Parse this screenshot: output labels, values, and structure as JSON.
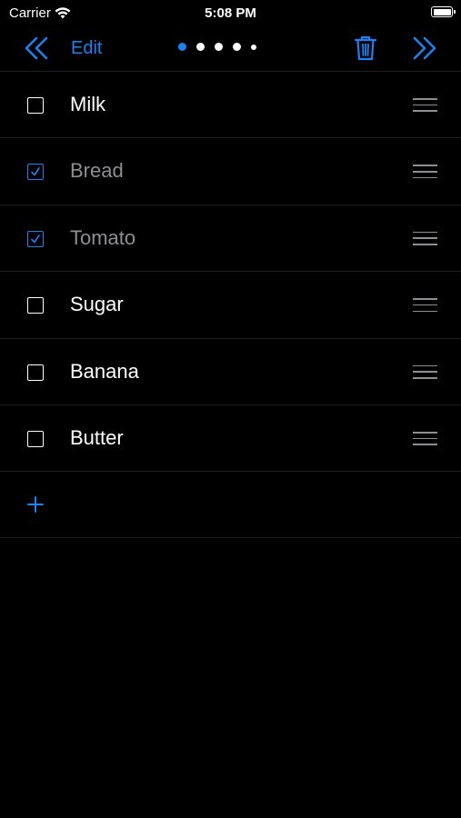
{
  "status_bar": {
    "carrier": "Carrier",
    "time": "5:08 PM"
  },
  "nav": {
    "back_icon": "double-chevron-left-icon",
    "edit_label": "Edit",
    "page_indicator": {
      "count": 5,
      "active_index": 0
    },
    "delete_icon": "trash-icon",
    "forward_icon": "double-chevron-right-icon"
  },
  "list": {
    "items": [
      {
        "label": "Milk",
        "checked": false
      },
      {
        "label": "Bread",
        "checked": true
      },
      {
        "label": "Tomato",
        "checked": true
      },
      {
        "label": "Sugar",
        "checked": false
      },
      {
        "label": "Banana",
        "checked": false
      },
      {
        "label": "Butter",
        "checked": false
      }
    ],
    "add_icon": "plus-icon"
  },
  "colors": {
    "accent": "#1a82f3",
    "background": "#000000",
    "checked_text": "#8e8e93",
    "separator": "#1f1f1f"
  }
}
